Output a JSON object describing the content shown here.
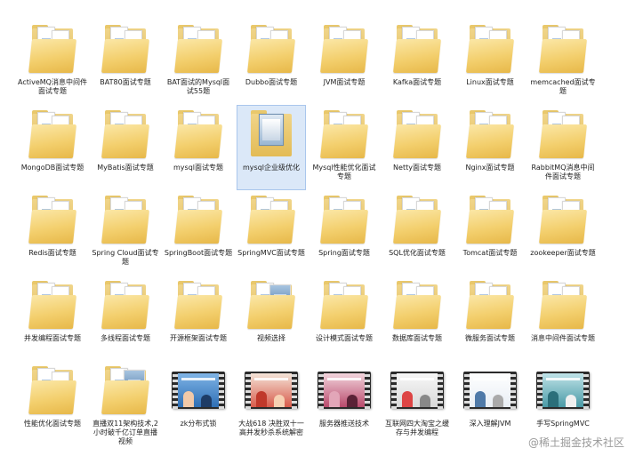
{
  "window": {
    "view": "large-icons"
  },
  "items": [
    {
      "label": "ActiveMQ消息中间件面试专题",
      "type": "folder"
    },
    {
      "label": "BAT80面试专题",
      "type": "folder"
    },
    {
      "label": "BAT面试的Mysql面试55题",
      "type": "folder"
    },
    {
      "label": "Dubbo面试专题",
      "type": "folder"
    },
    {
      "label": "JVM面试专题",
      "type": "folder"
    },
    {
      "label": "Kafka面试专题",
      "type": "folder"
    },
    {
      "label": "Linux面试专题",
      "type": "folder"
    },
    {
      "label": "memcached面试专题",
      "type": "folder"
    },
    {
      "label": "MongoDB面试专题",
      "type": "folder"
    },
    {
      "label": "MyBatis面试专题",
      "type": "folder"
    },
    {
      "label": "mysql面试专题",
      "type": "folder"
    },
    {
      "label": "mysql企业级优化",
      "type": "folder-preview",
      "selected": true
    },
    {
      "label": "Mysql性能优化面试专题",
      "type": "folder"
    },
    {
      "label": "Netty面试专题",
      "type": "folder"
    },
    {
      "label": "Nginx面试专题",
      "type": "folder"
    },
    {
      "label": "RabbitMQ消息中间件面试专题",
      "type": "folder"
    },
    {
      "label": "Redis面试专题",
      "type": "folder"
    },
    {
      "label": "Spring Cloud面试专题",
      "type": "folder"
    },
    {
      "label": "SpringBoot面试专题",
      "type": "folder"
    },
    {
      "label": "SpringMVC面试专题",
      "type": "folder"
    },
    {
      "label": "Spring面试专题",
      "type": "folder"
    },
    {
      "label": "SQL优化面试专题",
      "type": "folder"
    },
    {
      "label": "Tomcat面试专题",
      "type": "folder"
    },
    {
      "label": "zookeeper面试专题",
      "type": "folder"
    },
    {
      "label": "并发编程面试专题",
      "type": "folder"
    },
    {
      "label": "多线程面试专题",
      "type": "folder"
    },
    {
      "label": "开源框架面试专题",
      "type": "folder"
    },
    {
      "label": "视频选择",
      "type": "folder-video"
    },
    {
      "label": "设计模式面试专题",
      "type": "folder"
    },
    {
      "label": "数据库面试专题",
      "type": "folder"
    },
    {
      "label": "微服务面试专题",
      "type": "folder"
    },
    {
      "label": "消息中间件面试专题",
      "type": "folder"
    },
    {
      "label": "性能优化面试专题",
      "type": "folder"
    },
    {
      "label": "直播双11架构技术,2小时破千亿订单直播视频",
      "type": "folder-video"
    },
    {
      "label": "zk分布式锁",
      "type": "video",
      "theme": "blue"
    },
    {
      "label": "大战618 决胜双十一高并发秒杀系统解密",
      "type": "video",
      "theme": "red"
    },
    {
      "label": "服务器推送技术",
      "type": "video",
      "theme": "pink"
    },
    {
      "label": "互联网四大淘宝之缓存与并发编程",
      "type": "video",
      "theme": "white"
    },
    {
      "label": "深入理解JVM",
      "type": "video",
      "theme": "white2"
    },
    {
      "label": "手写SpringMVC",
      "type": "video",
      "theme": "teal"
    }
  ],
  "watermark": "@稀土掘金技术社区",
  "colors": {
    "selection_bg": "#dbe8f8",
    "selection_border": "#a9c6ec",
    "folder": "#f3cf6d"
  }
}
